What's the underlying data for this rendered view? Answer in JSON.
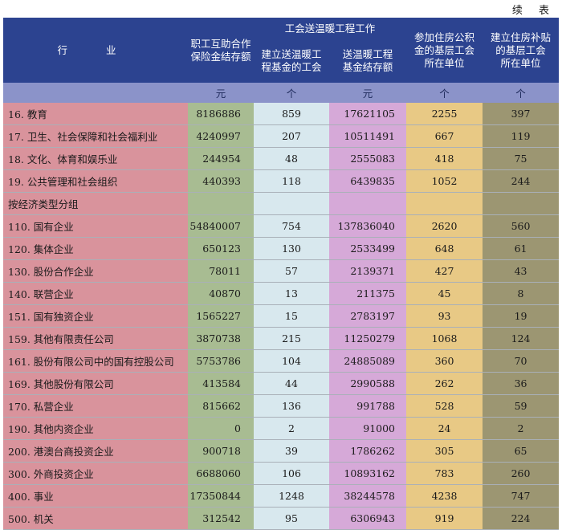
{
  "continued": "续 表",
  "header": {
    "industry": "行 业",
    "col1": [
      "职工互助合作",
      "保险金结存额"
    ],
    "group": "工会送温暖工程工作",
    "col2": [
      "建立送温暖工",
      "程基金的工会"
    ],
    "col3": [
      "送温暖工程",
      "基金结存额"
    ],
    "col4": [
      "参加住房公积",
      "金的基层工会",
      "所在单位"
    ],
    "col5": [
      "建立住房补贴",
      "的基层工会",
      "所在单位"
    ],
    "units": [
      "元",
      "个",
      "元",
      "个",
      "个"
    ]
  },
  "rows": [
    {
      "label": "16. 教育",
      "v": [
        "8186886",
        "859",
        "17621105",
        "2255",
        "397"
      ]
    },
    {
      "label": "17. 卫生、社会保障和社会福利业",
      "v": [
        "4240997",
        "207",
        "10511491",
        "667",
        "119"
      ]
    },
    {
      "label": "18. 文化、体育和娱乐业",
      "v": [
        "244954",
        "48",
        "2555083",
        "418",
        "75"
      ]
    },
    {
      "label": "19. 公共管理和社会组织",
      "v": [
        "440393",
        "118",
        "6439835",
        "1052",
        "244"
      ]
    },
    {
      "label": "按经济类型分组",
      "v": [
        "",
        "",
        "",
        "",
        ""
      ]
    },
    {
      "label": "110. 国有企业",
      "v": [
        "54840007",
        "754",
        "137836040",
        "2620",
        "560"
      ]
    },
    {
      "label": "120. 集体企业",
      "v": [
        "650123",
        "130",
        "2533499",
        "648",
        "61"
      ]
    },
    {
      "label": "130. 股份合作企业",
      "v": [
        "78011",
        "57",
        "2139371",
        "427",
        "43"
      ]
    },
    {
      "label": "140. 联营企业",
      "v": [
        "40870",
        "13",
        "211375",
        "45",
        "8"
      ]
    },
    {
      "label": "151. 国有独资企业",
      "v": [
        "1565227",
        "15",
        "2783197",
        "93",
        "19"
      ]
    },
    {
      "label": "159. 其他有限责任公司",
      "v": [
        "3870738",
        "215",
        "11250279",
        "1068",
        "124"
      ]
    },
    {
      "label": "161. 股份有限公司中的国有控股公司",
      "v": [
        "5753786",
        "104",
        "24885089",
        "360",
        "70"
      ]
    },
    {
      "label": "169. 其他股份有限公司",
      "v": [
        "413584",
        "44",
        "2990588",
        "262",
        "36"
      ]
    },
    {
      "label": "170. 私营企业",
      "v": [
        "815662",
        "136",
        "991788",
        "528",
        "59"
      ]
    },
    {
      "label": "190. 其他内资企业",
      "v": [
        "0",
        "2",
        "91000",
        "24",
        "2"
      ]
    },
    {
      "label": "200. 港澳台商投资企业",
      "v": [
        "900718",
        "39",
        "1786262",
        "305",
        "65"
      ]
    },
    {
      "label": "300. 外商投资企业",
      "v": [
        "6688060",
        "106",
        "10893162",
        "783",
        "260"
      ]
    },
    {
      "label": "400. 事业",
      "v": [
        "17350844",
        "1248",
        "38244578",
        "4238",
        "747"
      ]
    },
    {
      "label": "500. 机关",
      "v": [
        "312542",
        "95",
        "6306943",
        "919",
        "224"
      ]
    }
  ]
}
